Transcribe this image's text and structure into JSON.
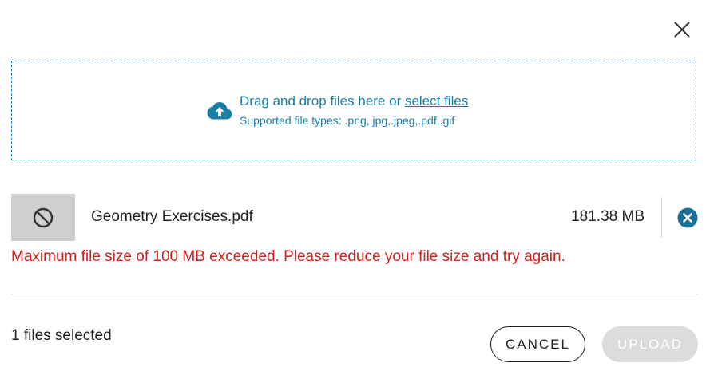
{
  "dialog": {
    "close_icon": "close-icon"
  },
  "dropzone": {
    "icon": "cloud-upload-icon",
    "prompt_text": "Drag and drop files here or ",
    "select_link": "select files",
    "supported_types": "Supported file types: .png,.jpg,.jpeg,.pdf,.gif"
  },
  "files": [
    {
      "thumbnail_icon": "blocked-icon",
      "name": "Geometry Exercises.pdf",
      "size": "181.38 MB",
      "remove_icon": "remove-icon",
      "error": "Maximum file size of 100 MB exceeded. Please reduce your file size and try again."
    }
  ],
  "footer": {
    "files_selected": "1 files selected",
    "cancel_label": "CANCEL",
    "upload_label": "UPLOAD",
    "upload_disabled": true
  },
  "colors": {
    "accent": "#1a7fa6",
    "error": "#d0211c",
    "remove_button": "#1b6f94",
    "thumbnail_bg": "#cfcfcf",
    "disabled_button_bg": "#dcdcdc"
  }
}
